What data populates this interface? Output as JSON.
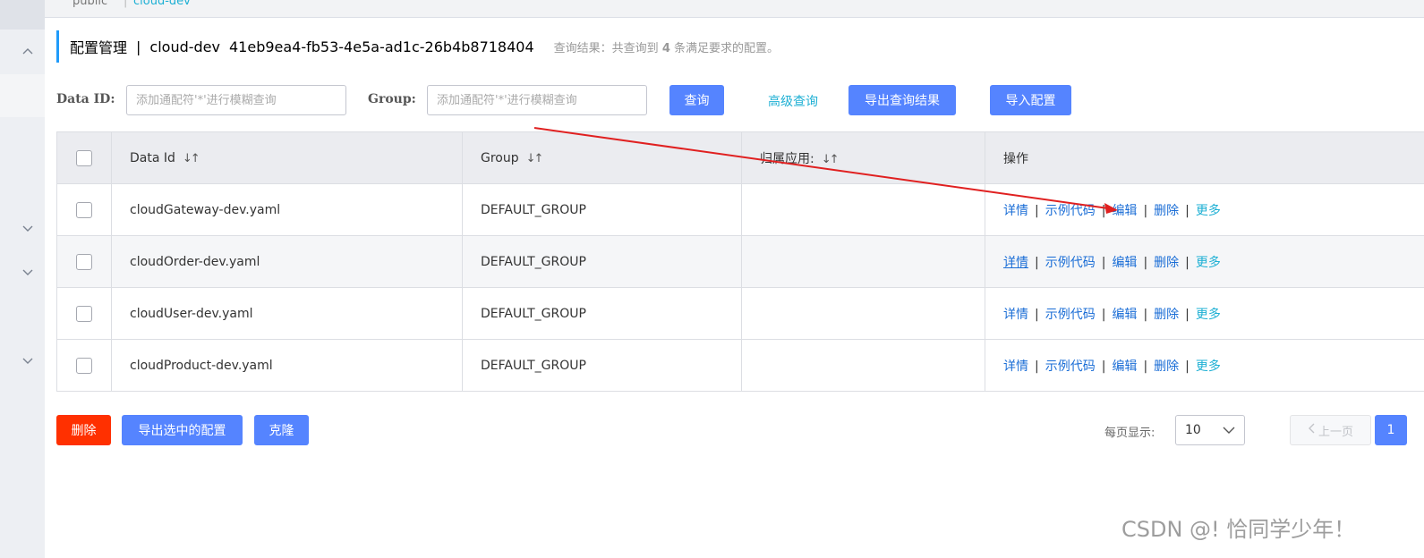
{
  "colors": {
    "primary": "#5584ff",
    "danger": "#ff3000",
    "link": "#1a6dd6",
    "link_alt": "#1fb0d4",
    "accent_bar": "#209bfa",
    "annotation_arrow": "#e02020"
  },
  "breadcrumb": {
    "namespace": "public",
    "active": "cloud-dev"
  },
  "header": {
    "title": "配置管理",
    "separator": "|",
    "namespace_name": "cloud-dev",
    "namespace_id": "41eb9ea4-fb53-4e5a-ad1c-26b4b8718404",
    "result_prefix": "查询结果：共查询到",
    "result_count": "4",
    "result_suffix": "条满足要求的配置。"
  },
  "search": {
    "data_id_label": "Data ID:",
    "data_id_placeholder": "添加通配符'*'进行模糊查询",
    "data_id_value": "",
    "group_label": "Group:",
    "group_placeholder": "添加通配符'*'进行模糊查询",
    "group_value": "",
    "query_button": "查询",
    "advanced_link": "高级查询",
    "export_results_button": "导出查询结果",
    "import_button": "导入配置"
  },
  "table": {
    "columns": [
      "Data Id",
      "Group",
      "归属应用:",
      "操作"
    ],
    "rows": [
      {
        "data_id": "cloudGateway-dev.yaml",
        "group": "DEFAULT_GROUP",
        "app": ""
      },
      {
        "data_id": "cloudOrder-dev.yaml",
        "group": "DEFAULT_GROUP",
        "app": ""
      },
      {
        "data_id": "cloudUser-dev.yaml",
        "group": "DEFAULT_GROUP",
        "app": ""
      },
      {
        "data_id": "cloudProduct-dev.yaml",
        "group": "DEFAULT_GROUP",
        "app": ""
      }
    ],
    "actions": {
      "detail": "详情",
      "sample_code": "示例代码",
      "edit": "编辑",
      "delete": "删除",
      "more": "更多",
      "separator": "|"
    }
  },
  "bottom": {
    "delete_button": "删除",
    "export_selected_button": "导出选中的配置",
    "clone_button": "克隆",
    "page_size_label": "每页显示:",
    "page_size_value": "10",
    "prev_page": "上一页",
    "current_page": "1"
  },
  "watermark": "CSDN @! 恰同学少年！"
}
